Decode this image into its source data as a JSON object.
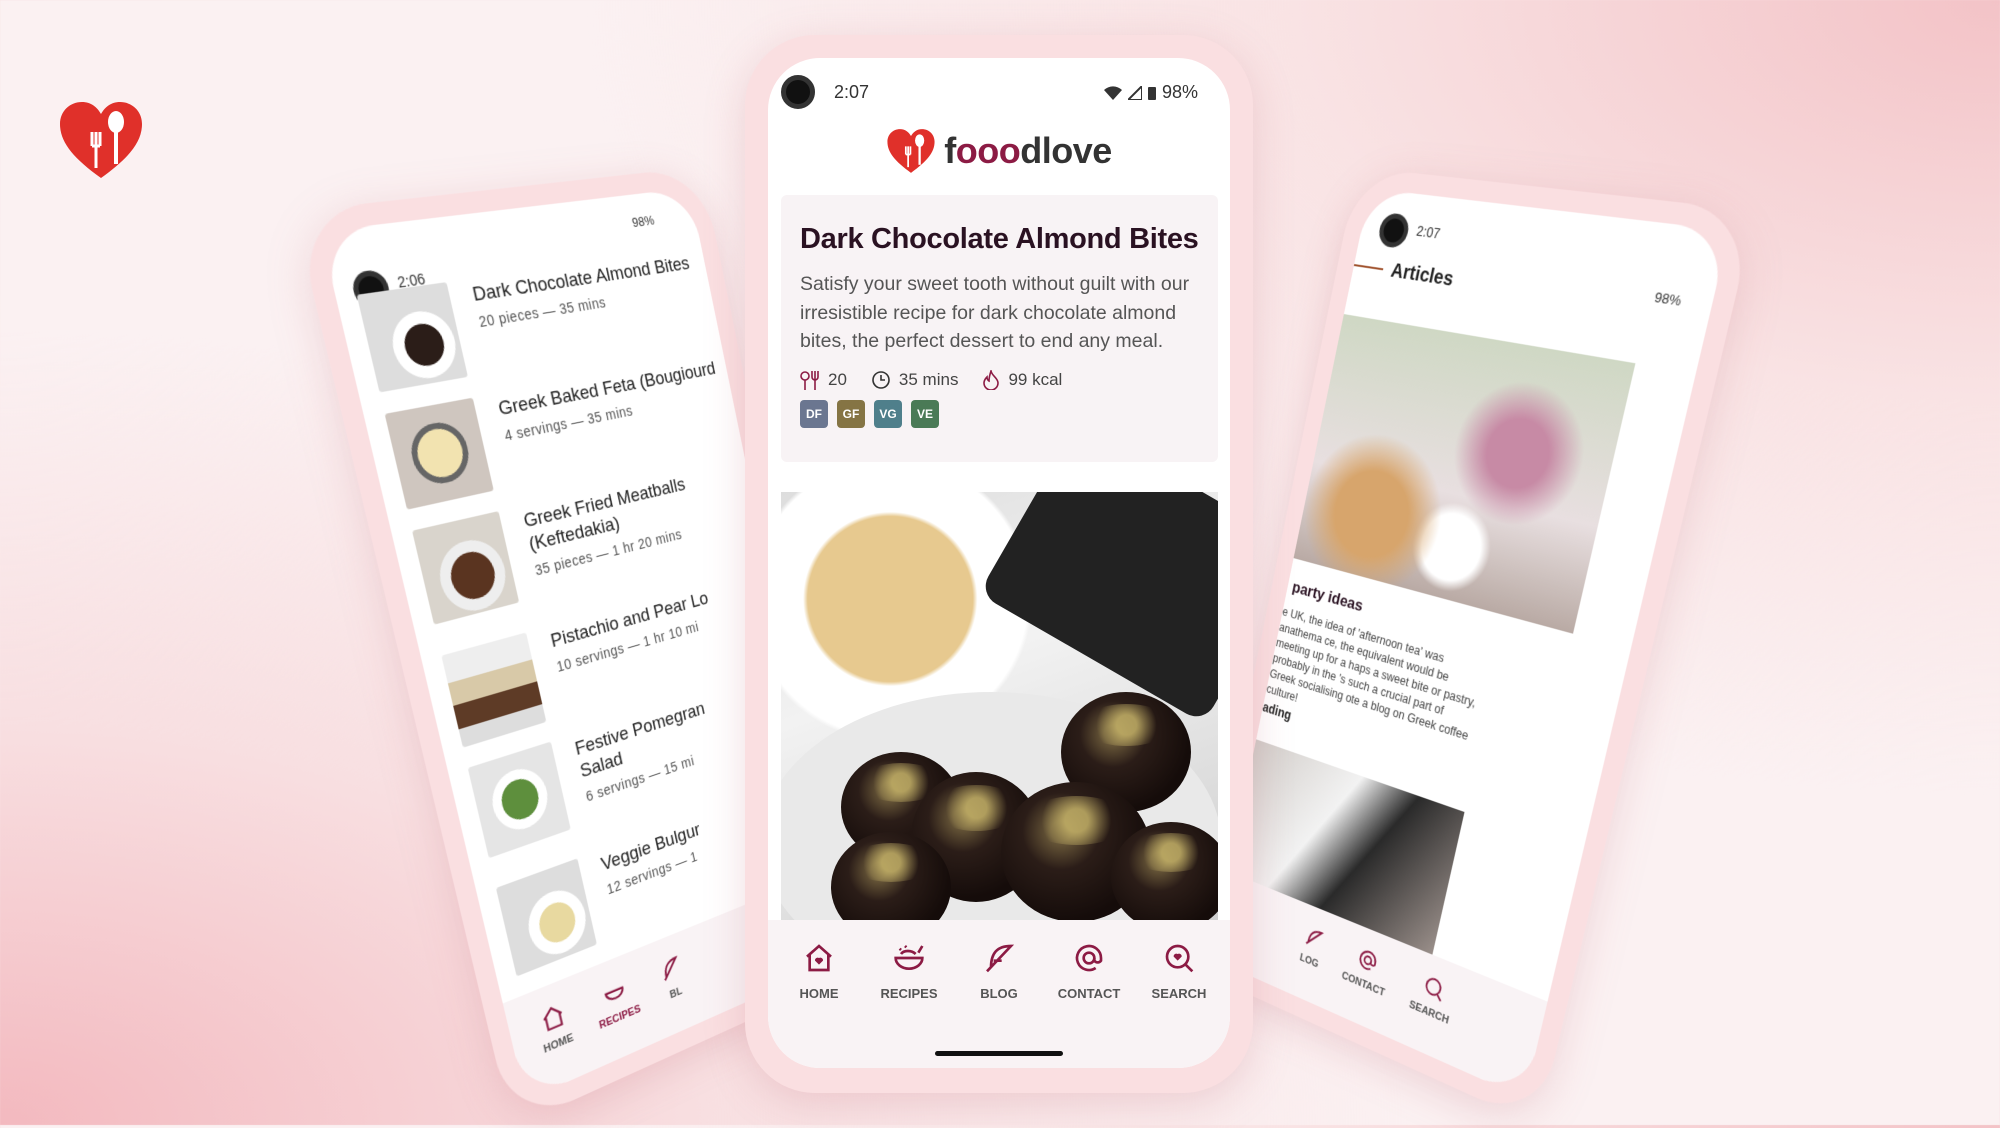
{
  "brand": {
    "name_prefix": "f",
    "name_o": "ooo",
    "name_suffix": "dlove",
    "accent": "#8c1b44",
    "heart_color": "#e0302a"
  },
  "center": {
    "status": {
      "time": "2:07",
      "battery": "98%"
    },
    "recipe": {
      "title": "Dark Chocolate Almond Bites",
      "description": "Satisfy your sweet tooth without guilt with our irresistible recipe for dark chocolate almond bites, the perfect dessert to end any meal.",
      "servings": "20",
      "time": "35 mins",
      "calories": "99 kcal",
      "tags": [
        {
          "label": "DF",
          "color": "#6b7690"
        },
        {
          "label": "GF",
          "color": "#857444"
        },
        {
          "label": "VG",
          "color": "#4f7f8b"
        },
        {
          "label": "VE",
          "color": "#4a7a56"
        }
      ]
    },
    "nav": [
      {
        "label": "HOME",
        "icon": "home-heart-icon"
      },
      {
        "label": "RECIPES",
        "icon": "bowl-icon"
      },
      {
        "label": "BLOG",
        "icon": "feather-icon"
      },
      {
        "label": "CONTACT",
        "icon": "at-icon"
      },
      {
        "label": "SEARCH",
        "icon": "search-heart-icon"
      }
    ]
  },
  "left": {
    "status": {
      "time": "2:06",
      "battery": "98%"
    },
    "recipes": [
      {
        "title": "Dark Chocolate Almond Bites",
        "sub": "20 pieces — 35 mins"
      },
      {
        "title": "Greek Baked Feta (Bougiourd",
        "sub": "4 servings — 35 mins"
      },
      {
        "title": "Greek Fried Meatballs (Keftedakia)",
        "sub": "35 pieces — 1 hr 20 mins"
      },
      {
        "title": "Pistachio and Pear Lo",
        "sub": "10 servings — 1 hr 10 mi"
      },
      {
        "title": "Festive Pomegran Salad",
        "sub": "6 servings — 15 mi"
      },
      {
        "title": "Veggie Bulgur",
        "sub": "12 servings — 1"
      }
    ],
    "nav": [
      "HOME",
      "RECIPES",
      "BL"
    ]
  },
  "right": {
    "status": {
      "time": "2:07",
      "battery": "98%"
    },
    "header": "Articles",
    "article": {
      "title": "party ideas",
      "excerpt": "e UK, the idea of 'afternoon tea' was anathema ce, the equivalent would be meeting up for a haps a sweet bite or pastry, probably in the 's such a crucial part of Greek socialising ote a blog on Greek coffee culture!",
      "link": "ading"
    },
    "nav": [
      "LOG",
      "CONTACT",
      "SEARCH"
    ]
  }
}
